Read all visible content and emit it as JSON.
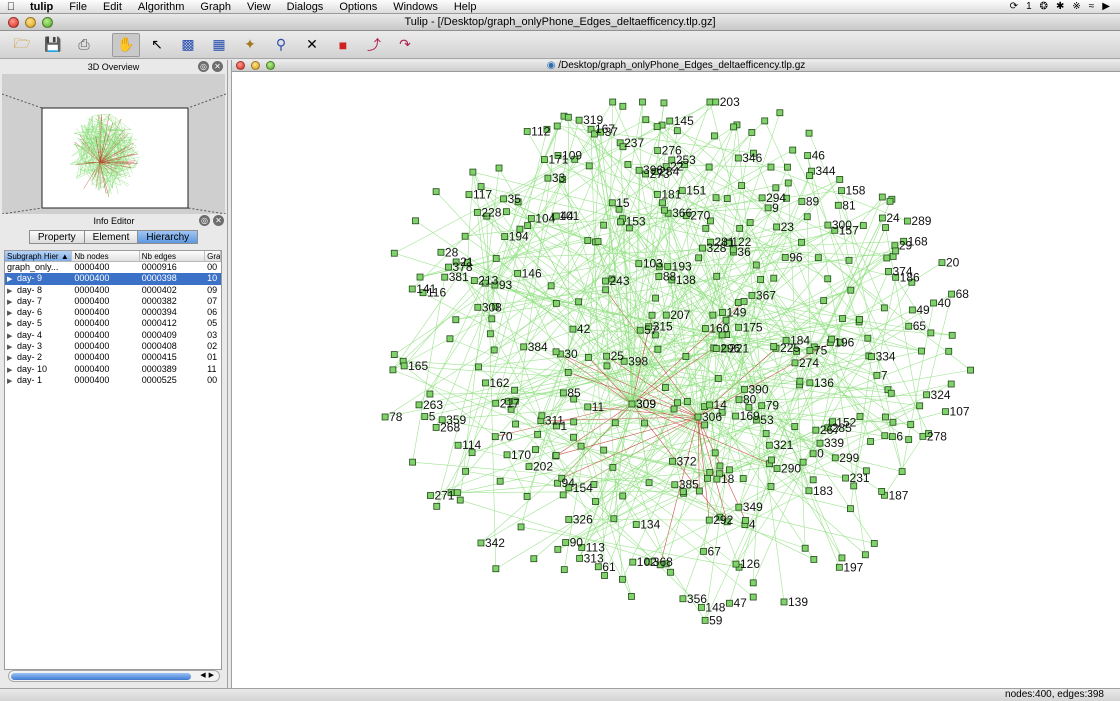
{
  "menubar": {
    "app": "tulip",
    "items": [
      "File",
      "Edit",
      "Algorithm",
      "Graph",
      "View",
      "Dialogs",
      "Options",
      "Windows",
      "Help"
    ],
    "status_count": "1"
  },
  "window": {
    "title": "Tulip - [/Desktop/graph_onlyPhone_Edges_deltaefficency.tlp.gz]"
  },
  "overview": {
    "title": "3D Overview"
  },
  "info_editor": {
    "title": "Info Editor",
    "tabs": [
      "Property",
      "Element",
      "Hierarchy"
    ],
    "selected_tab": "Hierarchy",
    "columns": [
      "Subgraph Hier",
      "Nb nodes",
      "Nb edges",
      "Gra"
    ],
    "rows": [
      {
        "name": "graph_only...",
        "nodes": "0000400",
        "edges": "0000916",
        "extra": "00",
        "child": false,
        "selected": false
      },
      {
        "name": "day- 9",
        "nodes": "0000400",
        "edges": "0000398",
        "extra": "10",
        "child": true,
        "selected": true
      },
      {
        "name": "day- 8",
        "nodes": "0000400",
        "edges": "0000402",
        "extra": "09",
        "child": true,
        "selected": false
      },
      {
        "name": "day- 7",
        "nodes": "0000400",
        "edges": "0000382",
        "extra": "07",
        "child": true,
        "selected": false
      },
      {
        "name": "day- 6",
        "nodes": "0000400",
        "edges": "0000394",
        "extra": "06",
        "child": true,
        "selected": false
      },
      {
        "name": "day- 5",
        "nodes": "0000400",
        "edges": "0000412",
        "extra": "05",
        "child": true,
        "selected": false
      },
      {
        "name": "day- 4",
        "nodes": "0000400",
        "edges": "0000409",
        "extra": "03",
        "child": true,
        "selected": false
      },
      {
        "name": "day- 3",
        "nodes": "0000400",
        "edges": "0000408",
        "extra": "02",
        "child": true,
        "selected": false
      },
      {
        "name": "day- 2",
        "nodes": "0000400",
        "edges": "0000415",
        "extra": "01",
        "child": true,
        "selected": false
      },
      {
        "name": "day- 10",
        "nodes": "0000400",
        "edges": "0000389",
        "extra": "11",
        "child": true,
        "selected": false
      },
      {
        "name": "day- 1",
        "nodes": "0000400",
        "edges": "0000525",
        "extra": "00",
        "child": true,
        "selected": false
      }
    ]
  },
  "graph_view": {
    "title": "/Desktop/graph_onlyPhone_Edges_deltaefficency.tlp.gz",
    "node_color": "#7fd36a",
    "edge_color": "#8ee07e",
    "hub_edge_color": "#c0392b",
    "hub_labels": [
      "309",
      "306"
    ],
    "labels": [
      "396",
      "122",
      "29",
      "289",
      "311",
      "213",
      "112",
      "326",
      "104",
      "146",
      "285",
      "359",
      "366",
      "22",
      "183",
      "139",
      "278",
      "309",
      "151",
      "157",
      "349",
      "243",
      "85",
      "207",
      "101",
      "221",
      "390",
      "126",
      "170",
      "30",
      "93",
      "11",
      "40",
      "378",
      "70",
      "237",
      "168",
      "96",
      "24",
      "225",
      "186",
      "193",
      "37",
      "385",
      "15",
      "9",
      "103",
      "20",
      "290",
      "263",
      "203",
      "44",
      "94",
      "149",
      "75",
      "356",
      "81",
      "153",
      "294",
      "28",
      "217",
      "167",
      "113",
      "90",
      "14",
      "187",
      "194",
      "35",
      "0",
      "328",
      "284",
      "344",
      "158",
      "18",
      "267",
      "114",
      "5",
      "324",
      "270",
      "175",
      "46",
      "134",
      "228",
      "78",
      "23",
      "141",
      "160",
      "102",
      "321",
      "309",
      "306",
      "59",
      "162",
      "253",
      "116",
      "339",
      "202",
      "169",
      "300",
      "1",
      "79",
      "372",
      "184",
      "374",
      "346",
      "49",
      "7",
      "4",
      "109",
      "80",
      "319",
      "152",
      "181",
      "274",
      "107",
      "61",
      "57",
      "271",
      "42",
      "53",
      "6",
      "296",
      "268",
      "171",
      "273",
      "292",
      "138",
      "136",
      "47",
      "148",
      "342",
      "334",
      "68",
      "313",
      "231",
      "398",
      "21",
      "89",
      "196",
      "67",
      "65",
      "154",
      "368",
      "165",
      "308",
      "25",
      "299",
      "117",
      "276",
      "33",
      "281",
      "145",
      "381",
      "315",
      "36",
      "197",
      "88",
      "367",
      "384"
    ]
  },
  "status": {
    "text": "nodes:400, edges:398"
  }
}
